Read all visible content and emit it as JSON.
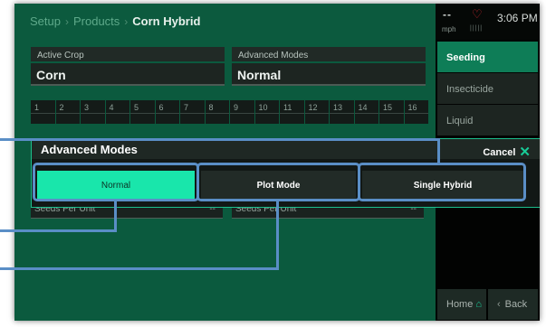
{
  "breadcrumb": {
    "items": [
      "Setup",
      "Products"
    ],
    "separator": "›",
    "current": "Corn Hybrid"
  },
  "status": {
    "speed": "--",
    "unit": "mph",
    "time": "3:06 PM",
    "heart_color": "#c2272e",
    "signal": "|||||"
  },
  "sidebar": {
    "tabs": [
      {
        "label": "Seeding"
      },
      {
        "label": "Insecticide"
      },
      {
        "label": "Liquid"
      }
    ],
    "home_label": "Home",
    "back_label": "Back"
  },
  "fields": [
    {
      "label": "Active Crop",
      "value": "Corn"
    },
    {
      "label": "Advanced Modes",
      "value": "Normal"
    }
  ],
  "row_numbers": [
    "1",
    "2",
    "3",
    "4",
    "5",
    "6",
    "7",
    "8",
    "9",
    "10",
    "11",
    "12",
    "13",
    "14",
    "15",
    "16"
  ],
  "seeds": [
    {
      "label": "Seeds Per Unit",
      "value": "--"
    },
    {
      "label": "Seeds Per Unit",
      "value": "--"
    }
  ],
  "modal": {
    "title": "Advanced Modes",
    "cancel_label": "Cancel",
    "options": [
      {
        "label": "Normal",
        "selected": true
      },
      {
        "label": "Plot Mode",
        "selected": false
      },
      {
        "label": "Single Hybrid",
        "selected": false
      }
    ]
  },
  "colors": {
    "accent": "#19e6ab",
    "background": "#0b5a3e",
    "highlight": "#5a8ec6",
    "alert": "#c2272e"
  }
}
